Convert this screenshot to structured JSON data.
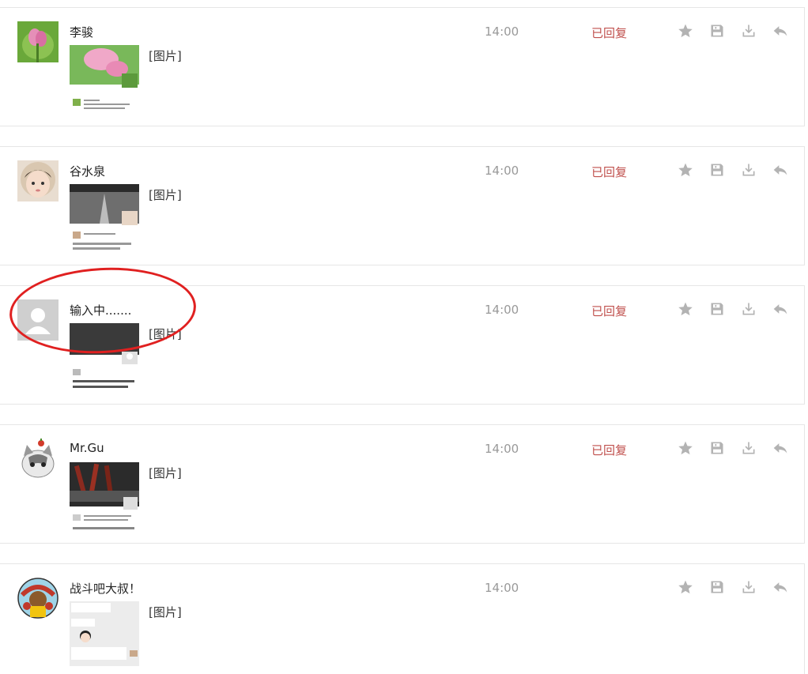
{
  "messages": [
    {
      "sender": "李骏",
      "attachment": "[图片]",
      "time": "14:00",
      "status": "已回复",
      "avatar": "lotus-photo",
      "thumb": "lotus-screenshot"
    },
    {
      "sender": "谷水泉",
      "attachment": "[图片]",
      "time": "14:00",
      "status": "已回复",
      "avatar": "child-photo",
      "thumb": "road-screenshot"
    },
    {
      "sender": "输入中.......",
      "attachment": "[图片]",
      "time": "14:00",
      "status": "已回复",
      "avatar": "default-user",
      "thumb": "dark-screenshot"
    },
    {
      "sender": "Mr.Gu",
      "attachment": "[图片]",
      "time": "14:00",
      "status": "已回复",
      "avatar": "cat-illustration",
      "thumb": "food-screenshot"
    },
    {
      "sender": "战斗吧大叔！",
      "attachment": "[图片]",
      "time": "14:00",
      "status": "",
      "avatar": "cartoon-badge",
      "thumb": "chat-screenshot"
    }
  ],
  "actions": {
    "star": "star-icon",
    "save": "floppy-disk-icon",
    "download": "download-icon",
    "reply": "reply-icon"
  },
  "colors": {
    "status_red": "#c0504d",
    "icon_gray": "#b3b3b3",
    "annotation_red": "#e02020",
    "border": "#e6e6e6"
  }
}
